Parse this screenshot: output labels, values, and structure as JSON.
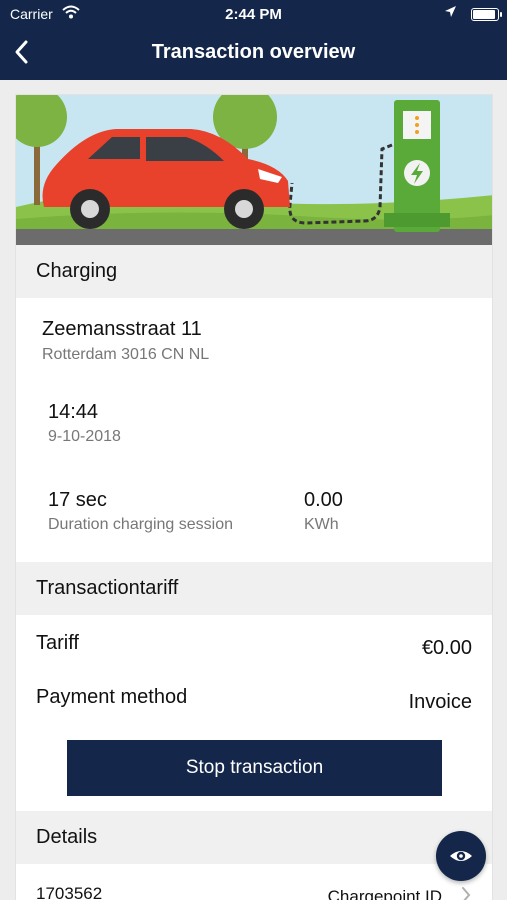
{
  "status_bar": {
    "carrier": "Carrier",
    "time": "2:44 PM",
    "battery_level": 0.95
  },
  "nav": {
    "title": "Transaction overview",
    "back_icon": "chevron-left-icon"
  },
  "hero": {
    "illustration": "car-charging-station-illustration"
  },
  "charging": {
    "header": "Charging",
    "address_line1": "Zeemansstraat 11",
    "address_line2": "Rotterdam 3016 CN NL",
    "time": "14:44",
    "date": "9-10-2018",
    "duration_value": "17 sec",
    "duration_label": "Duration charging session",
    "energy_value": "0.00",
    "energy_unit": "KWh"
  },
  "tariff": {
    "header": "Transactiontariff",
    "tariff_label": "Tariff",
    "tariff_value": "€0.00",
    "payment_label": "Payment method",
    "payment_value": "Invoice"
  },
  "actions": {
    "stop_label": "Stop transaction"
  },
  "details": {
    "header": "Details",
    "chargepoint_value": "1703562",
    "chargepoint_label": "Chargepoint ID"
  },
  "fab": {
    "icon": "eye-icon"
  },
  "colors": {
    "navy": "#14274a",
    "car_red": "#e8412c",
    "charger_green": "#5aaa3a"
  }
}
